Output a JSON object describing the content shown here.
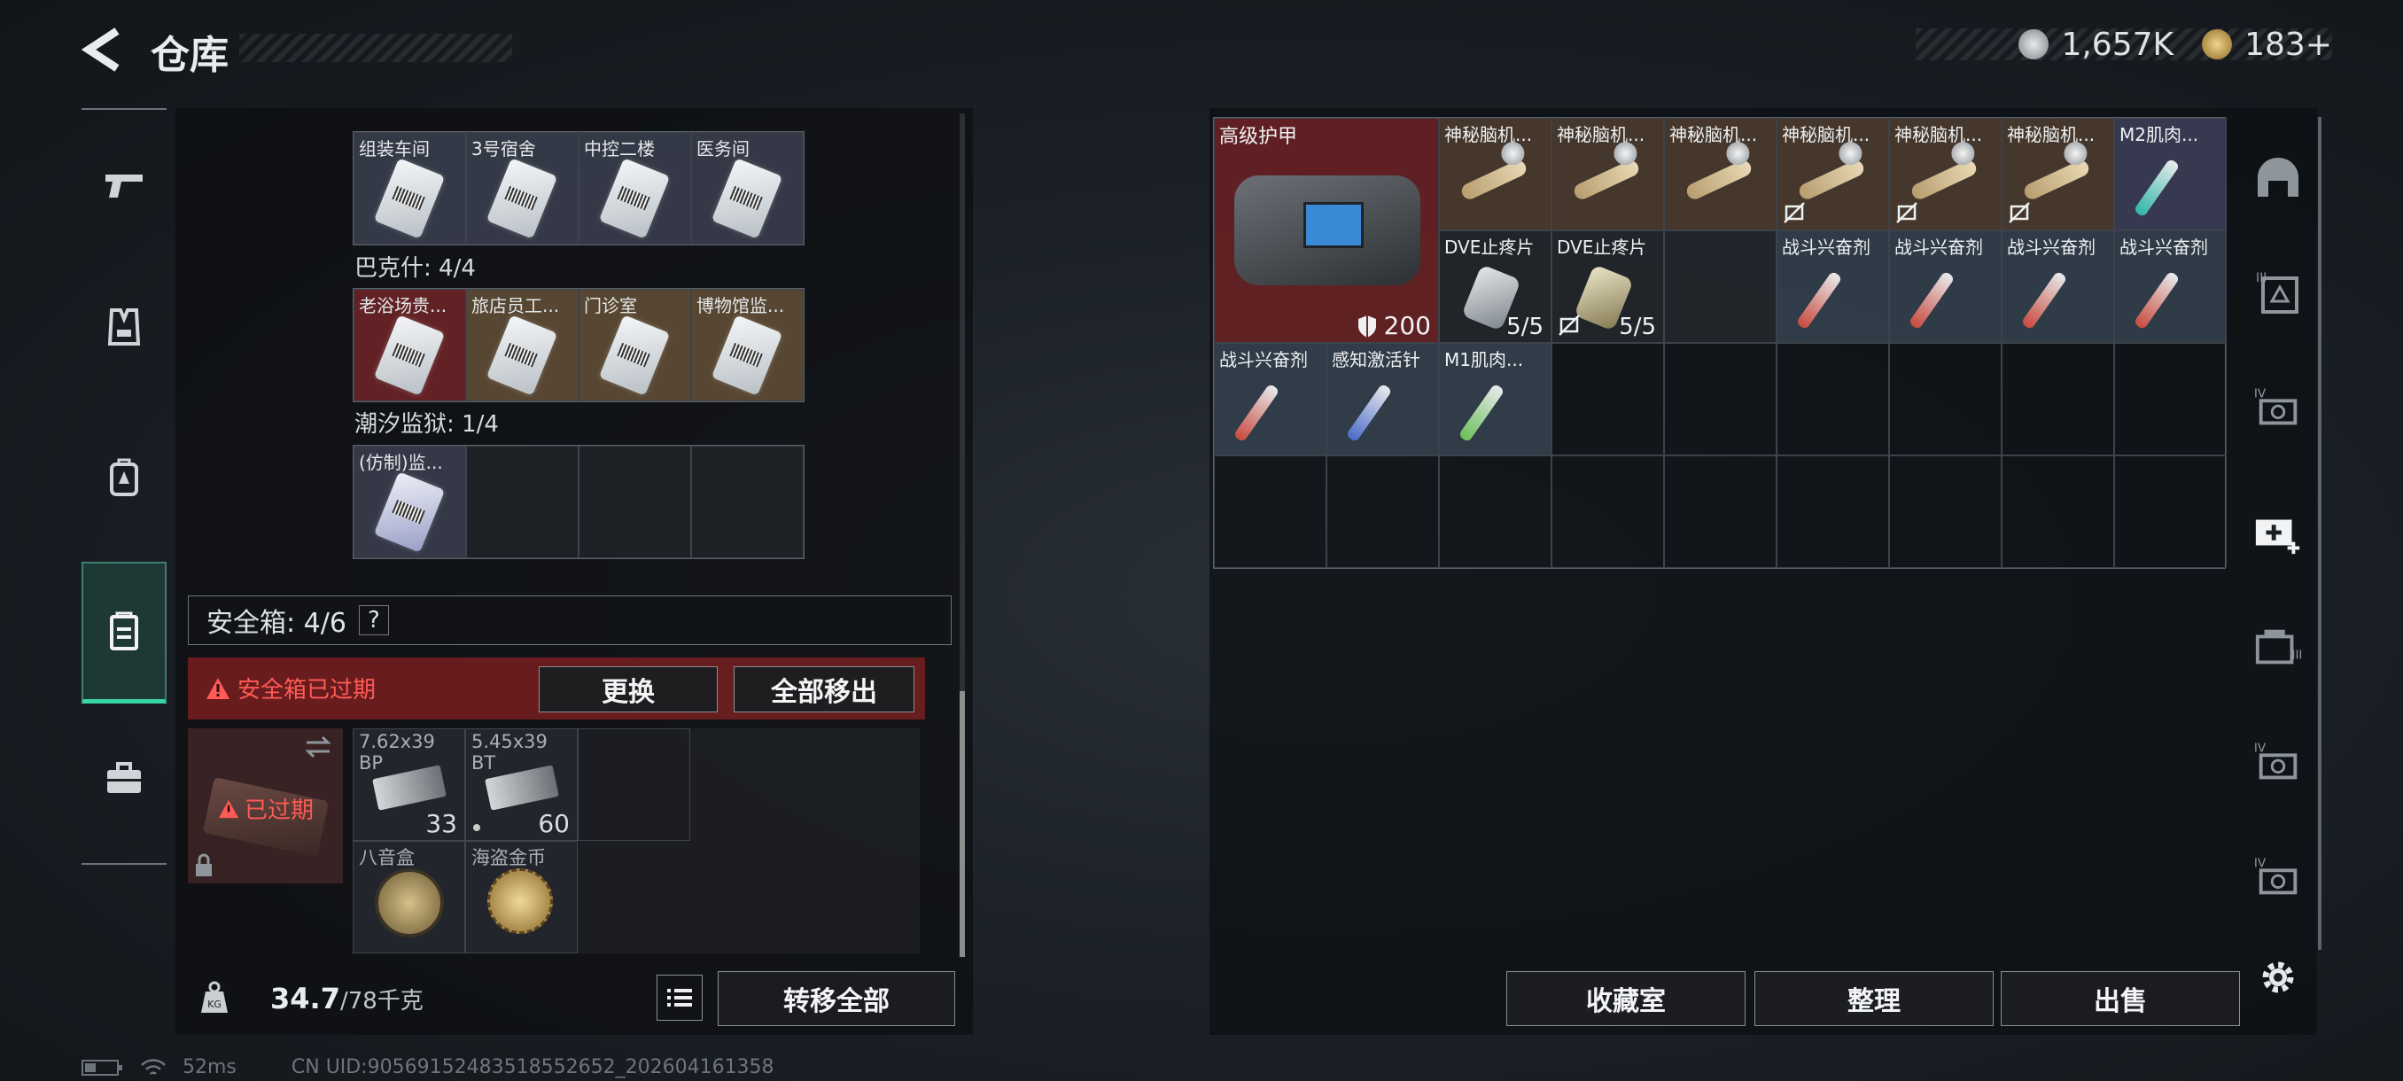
{
  "header": {
    "title": "仓库",
    "currency_primary": "1,657K",
    "currency_secondary": "183+"
  },
  "left_nav": {
    "items": [
      {
        "name": "weapons",
        "icon": "gun-icon"
      },
      {
        "name": "armor",
        "icon": "vest-icon"
      },
      {
        "name": "backpack",
        "icon": "backpack-icon"
      },
      {
        "name": "safe-box",
        "icon": "safebox-icon",
        "active": true
      },
      {
        "name": "toolbox",
        "icon": "briefcase-icon"
      }
    ]
  },
  "keycards": {
    "group1": {
      "items": [
        {
          "label": "组装车间"
        },
        {
          "label": "3号宿舍"
        },
        {
          "label": "中控二楼"
        },
        {
          "label": "医务间"
        }
      ]
    },
    "group2": {
      "title": "巴克什: 4/4",
      "items": [
        {
          "label": "老浴场贵...",
          "bg": "red"
        },
        {
          "label": "旅店员工...",
          "bg": "gold"
        },
        {
          "label": "门诊室",
          "bg": "gold"
        },
        {
          "label": "博物馆监...",
          "bg": "gold"
        }
      ]
    },
    "group3": {
      "title": "潮汐监狱: 1/4",
      "items": [
        {
          "label": "(仿制)监..."
        }
      ]
    }
  },
  "safe_box": {
    "title": "安全箱: 4/6",
    "help": "?",
    "expired_warning": "安全箱已过期",
    "replace_button": "更换",
    "move_all_button": "全部移出",
    "box_status": "已过期",
    "items": [
      {
        "label": "7.62x39 BP",
        "count": "33"
      },
      {
        "label": "5.45x39 BT",
        "count": "60"
      },
      {
        "label": "八音盒",
        "count": ""
      },
      {
        "label": "海盗金币",
        "count": ""
      }
    ]
  },
  "footer_left": {
    "weight_current": "34.7",
    "weight_max": "/78千克",
    "transfer_all": "转移全部"
  },
  "inventory": {
    "armor": {
      "label": "高级护甲",
      "durability": "200"
    },
    "row1": [
      {
        "label": "神秘脑机..."
      },
      {
        "label": "神秘脑机..."
      },
      {
        "label": "神秘脑机..."
      },
      {
        "label": "神秘脑机..."
      },
      {
        "label": "神秘脑机..."
      },
      {
        "label": "神秘脑机..."
      },
      {
        "label": "M2肌肉..."
      }
    ],
    "row2": [
      {
        "label": "DVE止疼片",
        "count": "5/5"
      },
      {
        "label": "DVE止疼片",
        "count": "5/5"
      },
      {
        "label": "战斗兴奋剂"
      },
      {
        "label": "战斗兴奋剂"
      },
      {
        "label": "战斗兴奋剂"
      },
      {
        "label": "战斗兴奋剂"
      }
    ],
    "row3": [
      {
        "label": "战斗兴奋剂"
      },
      {
        "label": "感知激活针"
      },
      {
        "label": "M1肌肉..."
      }
    ]
  },
  "footer_right": {
    "collection": "收藏室",
    "organize": "整理",
    "sell": "出售"
  },
  "status_bar": {
    "ping": "52ms",
    "uid": "CN UID:9056915248351855265​2_202604161358"
  },
  "colors": {
    "accent": "#39d3a4",
    "warning": "#ff5a55",
    "expired_bg": "#7a1e20"
  }
}
